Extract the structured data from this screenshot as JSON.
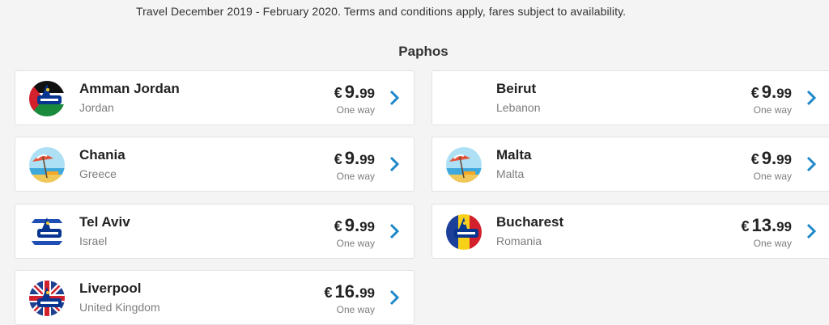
{
  "terms": "Travel December 2019 - February 2020. Terms and conditions apply, fares subject to availability.",
  "origin": "Paphos",
  "currency_symbol": "€",
  "accent_color": "#073590",
  "fares": [
    {
      "destination": "Amman Jordan",
      "country": "Jordan",
      "price_whole": "9.",
      "price_dec": "99",
      "trip": "One way",
      "icon": "jordan-flag-plane-icon"
    },
    {
      "destination": "Beirut",
      "country": "Lebanon",
      "price_whole": "9.",
      "price_dec": "99",
      "trip": "One way",
      "icon": "none"
    },
    {
      "destination": "Chania",
      "country": "Greece",
      "price_whole": "9.",
      "price_dec": "99",
      "trip": "One way",
      "icon": "beach-umbrella-icon"
    },
    {
      "destination": "Malta",
      "country": "Malta",
      "price_whole": "9.",
      "price_dec": "99",
      "trip": "One way",
      "icon": "beach-umbrella-icon"
    },
    {
      "destination": "Tel Aviv",
      "country": "Israel",
      "price_whole": "9.",
      "price_dec": "99",
      "trip": "One way",
      "icon": "israel-flag-plane-icon"
    },
    {
      "destination": "Bucharest",
      "country": "Romania",
      "price_whole": "13.",
      "price_dec": "99",
      "trip": "One way",
      "icon": "romania-flag-plane-icon"
    },
    {
      "destination": "Liverpool",
      "country": "United Kingdom",
      "price_whole": "16.",
      "price_dec": "99",
      "trip": "One way",
      "icon": "uk-flag-plane-icon"
    }
  ]
}
